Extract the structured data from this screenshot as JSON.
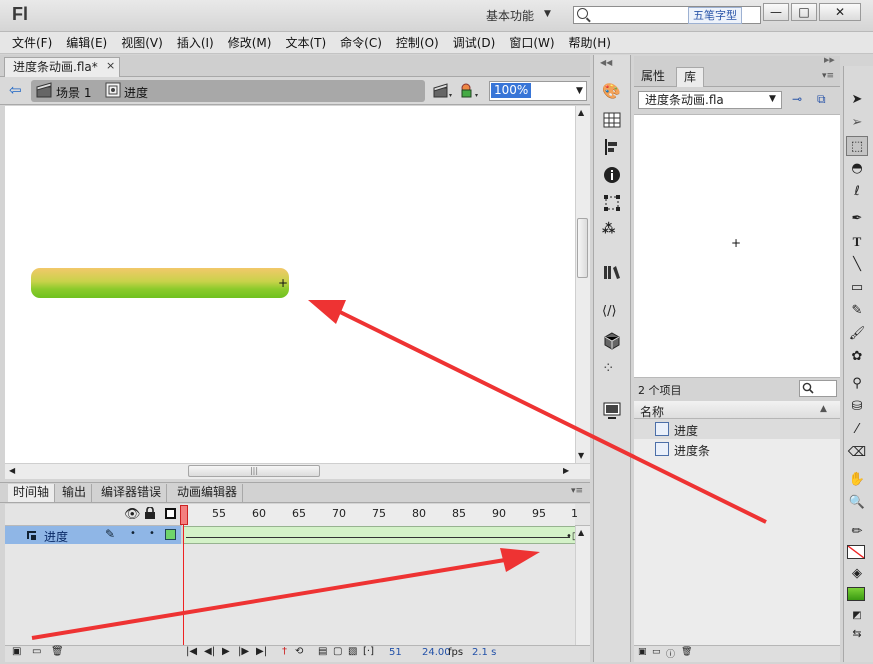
{
  "app": {
    "logo": "Fl",
    "workspace": "基本功能",
    "ime_label": "五笔字型"
  },
  "window_buttons": {
    "minimize": "—",
    "maximize": "□",
    "close": "✕"
  },
  "menu": [
    "文件(F)",
    "编辑(E)",
    "视图(V)",
    "插入(I)",
    "修改(M)",
    "文本(T)",
    "命令(C)",
    "控制(O)",
    "调试(D)",
    "窗口(W)",
    "帮助(H)"
  ],
  "document": {
    "tab_label": "进度条动画.fla*",
    "close": "×"
  },
  "editbar": {
    "scene": "场景 1",
    "symbol": "进度",
    "zoom": "100%"
  },
  "timeline": {
    "tabs": [
      "时间轴",
      "输出",
      "编译器错误",
      "动画编辑器"
    ],
    "frame_numbers": [
      "55",
      "60",
      "65",
      "70",
      "75",
      "80",
      "85",
      "90",
      "95",
      "1"
    ],
    "layer_name": "进度",
    "current_frame": "51",
    "fps": "24.00",
    "fps_unit": "fps",
    "time": "2.1 s"
  },
  "library": {
    "tab_props": "属性",
    "tab_library": "库",
    "file": "进度条动画.fla",
    "item_count": "2 个项目",
    "column_name": "名称",
    "items": [
      "进度",
      "进度条"
    ]
  },
  "colors": {
    "accent": "#3875d7",
    "layer_selected": "#8fb6e6",
    "frames_fill": "#d4f2c8",
    "playhead": "#e22222",
    "annotation_arrow": "#ee3333",
    "bar_top": "#f2c86a",
    "bar_bottom": "#6fc11f"
  }
}
